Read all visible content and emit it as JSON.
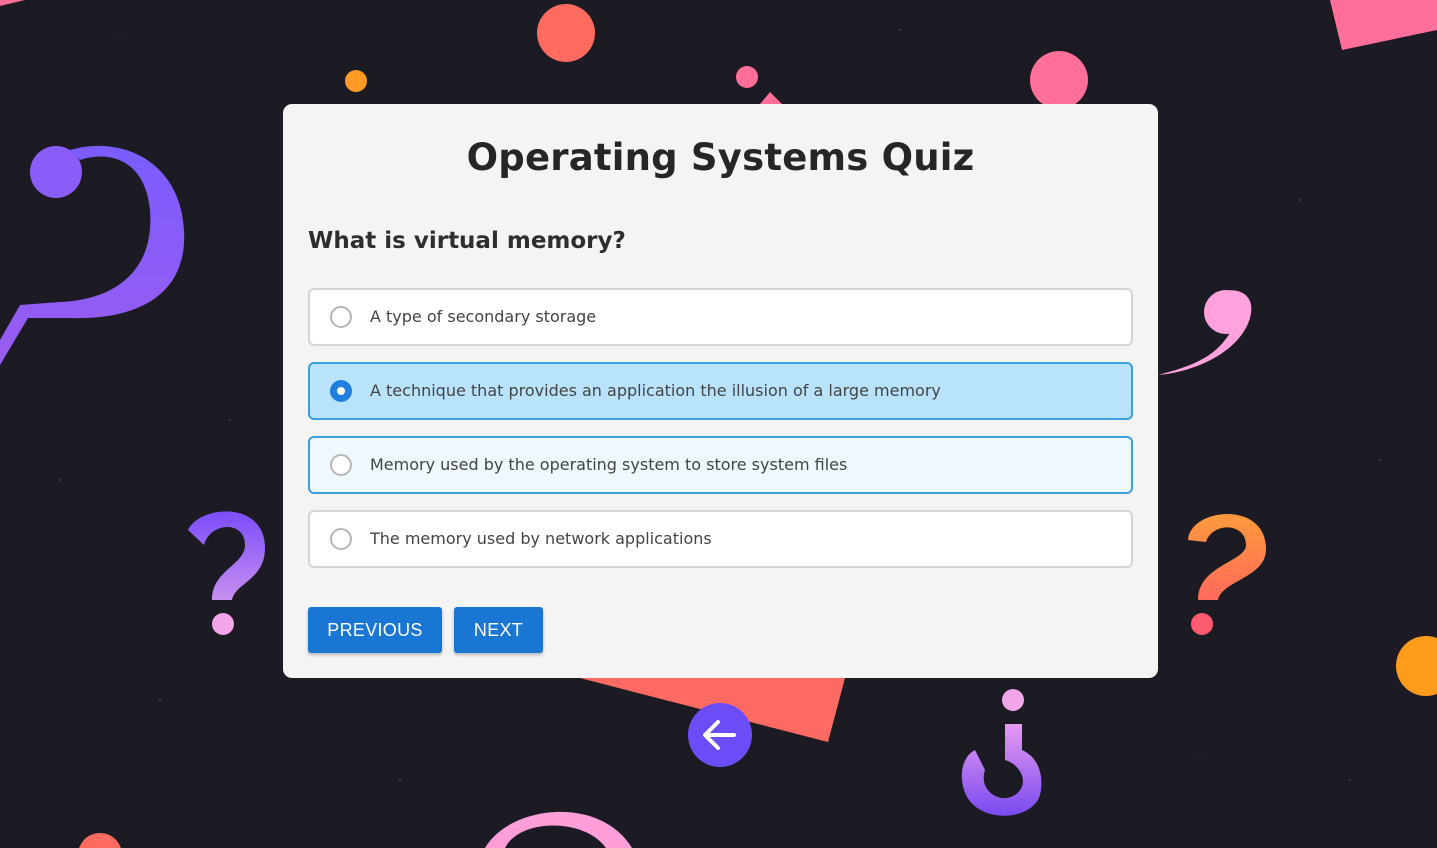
{
  "quiz": {
    "title": "Operating Systems Quiz",
    "question": "What is virtual memory?",
    "options": [
      {
        "label": "A type of secondary storage",
        "selected": false
      },
      {
        "label": "A technique that provides an application the illusion of a large memory",
        "selected": true
      },
      {
        "label": "Memory used by the operating system to store system files",
        "selected": false
      },
      {
        "label": "The memory used by network applications",
        "selected": false
      }
    ]
  },
  "buttons": {
    "previous_label": "PREVIOUS",
    "next_label": "NEXT"
  },
  "back_button": {
    "icon": "arrow-left-icon"
  },
  "colors": {
    "background": "#1c1b23",
    "card": "#f4f4f4",
    "primary_button": "#1976d2",
    "selected_option": "#b9e3fb",
    "selected_border": "#3b9fe0",
    "back_button": "#6b4cf6"
  }
}
